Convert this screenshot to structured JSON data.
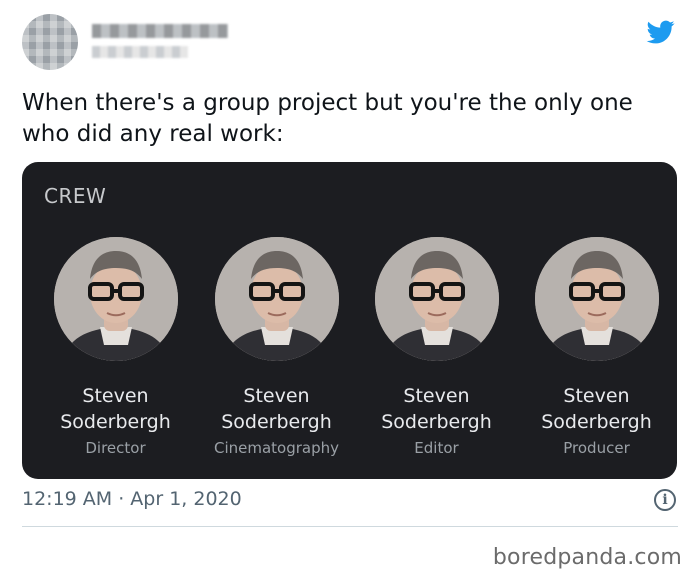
{
  "tweet": {
    "text": "When there's a group project but you're the only one who did any real work:",
    "timestamp": "12:19 AM · Apr 1, 2020",
    "icons": {
      "brand": "twitter-bird-icon",
      "info": "info-icon"
    },
    "brand_color": "#1d9bf0"
  },
  "card": {
    "section_label": "CREW",
    "members": [
      {
        "name_line1": "Steven",
        "name_line2": "Soderbergh",
        "role": "Director"
      },
      {
        "name_line1": "Steven",
        "name_line2": "Soderbergh",
        "role": "Cinematography"
      },
      {
        "name_line1": "Steven",
        "name_line2": "Soderbergh",
        "role": "Editor"
      },
      {
        "name_line1": "Steven",
        "name_line2": "Soderbergh",
        "role": "Producer"
      }
    ]
  },
  "watermark": "boredpanda.com"
}
